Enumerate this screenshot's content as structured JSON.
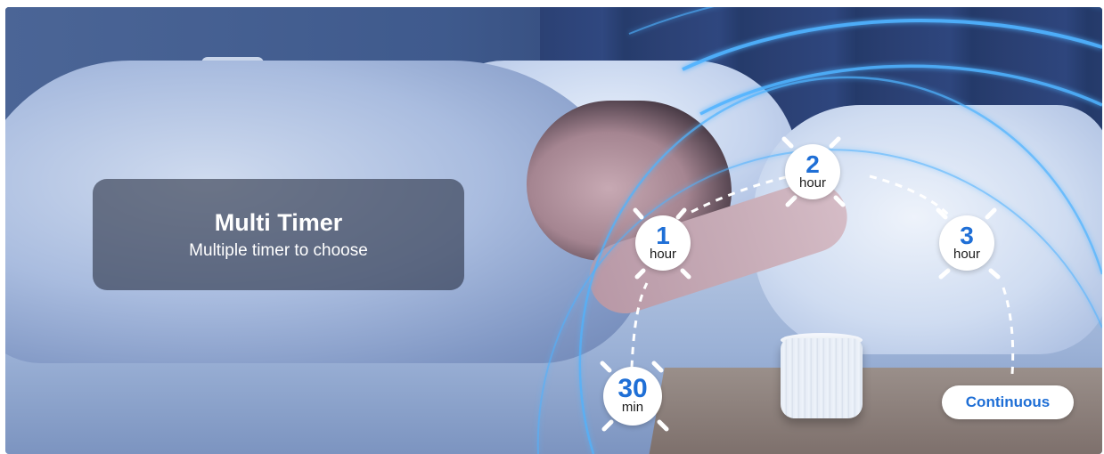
{
  "panel": {
    "title": "Multi Timer",
    "subtitle": "Multiple timer to choose"
  },
  "timers": [
    {
      "number": "30",
      "unit": "min"
    },
    {
      "number": "1",
      "unit": "hour"
    },
    {
      "number": "2",
      "unit": "hour"
    },
    {
      "number": "3",
      "unit": "hour"
    }
  ],
  "continuous_label": "Continuous",
  "colors": {
    "accent": "#1f6fd6",
    "glow": "#4fb3ff"
  }
}
